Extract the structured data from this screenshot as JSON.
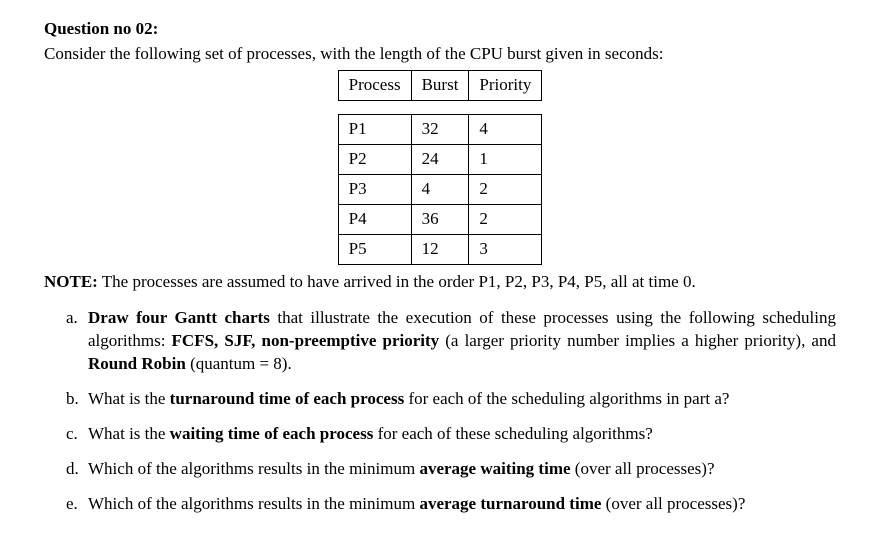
{
  "title": "Question no 02:",
  "intro": "Consider the following set of processes, with the length of the CPU burst given in seconds:",
  "table": {
    "headers": {
      "c1": "Process",
      "c2": "Burst",
      "c3": "Priority"
    },
    "rows": [
      {
        "c1": "P1",
        "c2": "32",
        "c3": "4"
      },
      {
        "c1": "P2",
        "c2": "24",
        "c3": "1"
      },
      {
        "c1": "P3",
        "c2": "4",
        "c3": "2"
      },
      {
        "c1": "P4",
        "c2": "36",
        "c3": "2"
      },
      {
        "c1": "P5",
        "c2": "12",
        "c3": "3"
      }
    ]
  },
  "note": {
    "label": "NOTE:",
    "text": " The processes are assumed to have arrived in the order P1, P2, P3, P4, P5, all at time 0."
  },
  "qa": {
    "marker": "a.",
    "p1": " Draw four Gantt charts",
    "p2": " that illustrate the execution of these processes using the following scheduling algorithms: ",
    "p3": "FCFS, SJF, non-preemptive priority",
    "p4": " (a larger priority number implies a higher priority), and ",
    "p5": "Round Robin",
    "p6": " (quantum = 8)."
  },
  "qb": {
    "marker": "b.",
    "p1": " What is the ",
    "p2": "turnaround time of each process",
    "p3": " for each of the scheduling algorithms in part a?"
  },
  "qc": {
    "marker": "c.",
    "p1": " What is the ",
    "p2": "waiting time of each process",
    "p3": " for each of these scheduling algorithms?"
  },
  "qd": {
    "marker": "d.",
    "p1": " Which of the algorithms results in the minimum ",
    "p2": "average waiting time",
    "p3": " (over all processes)?"
  },
  "qe": {
    "marker": "e.",
    "p1": " Which of the algorithms results in the minimum ",
    "p2": "average turnaround time",
    "p3": " (over all processes)?"
  }
}
